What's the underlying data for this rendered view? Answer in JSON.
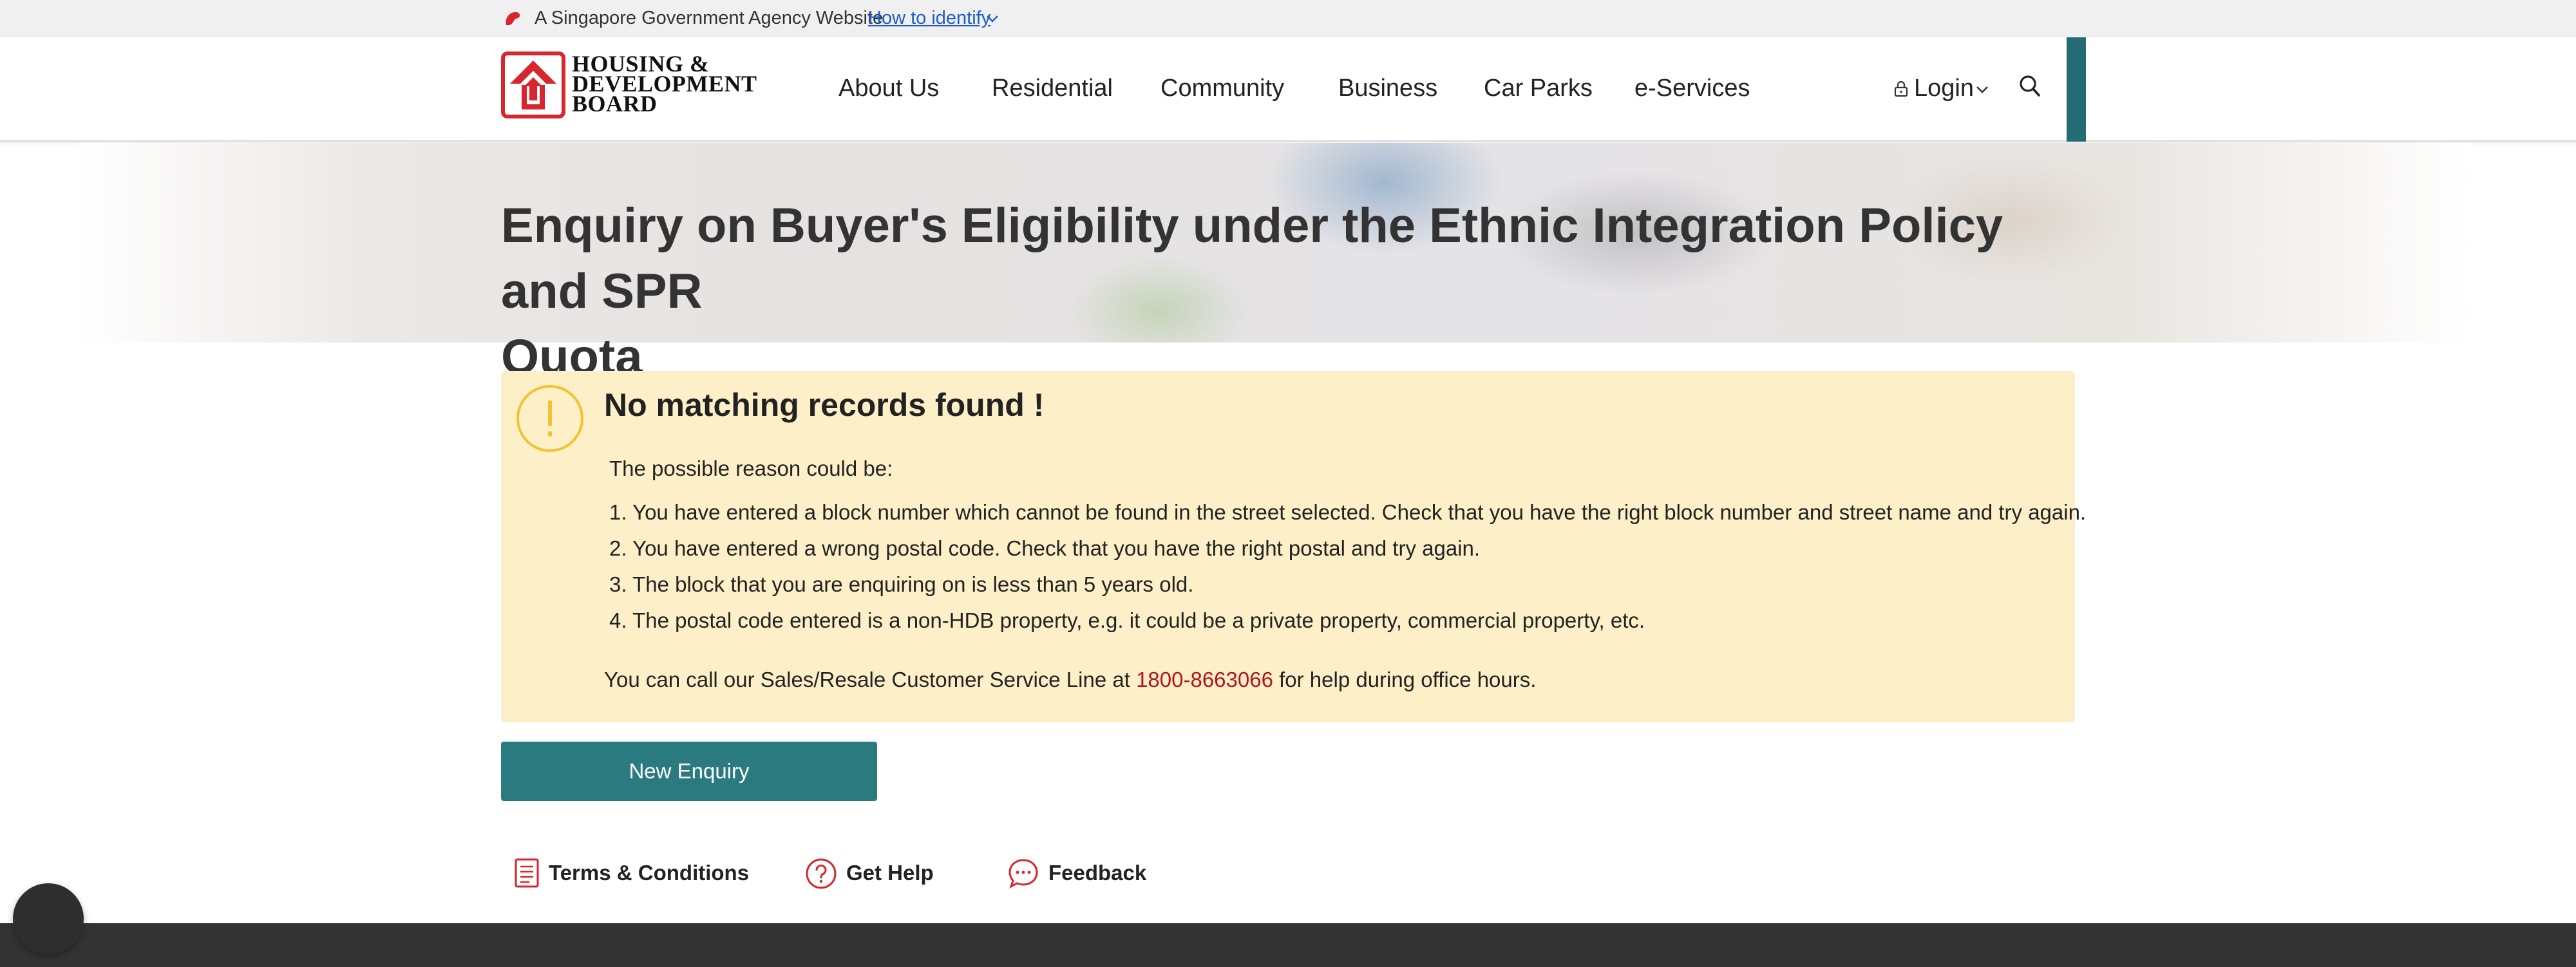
{
  "masthead": {
    "gov_text": "A Singapore Government Agency Website",
    "identify_link": "How to identify"
  },
  "header": {
    "logo_lines": [
      "HOUSING &",
      "DEVELOPMENT",
      "BOARD"
    ],
    "nav": [
      {
        "label": "About Us"
      },
      {
        "label": "Residential"
      },
      {
        "label": "Community"
      },
      {
        "label": "Business"
      },
      {
        "label": "Car Parks"
      },
      {
        "label": "e-Services"
      }
    ],
    "login_label": "Login"
  },
  "hero": {
    "title_line1": "Enquiry on Buyer's Eligibility under the Ethnic Integration Policy and SPR",
    "title_line2": "Quota"
  },
  "alert": {
    "title": "No matching records found !",
    "intro": "The possible reason could be:",
    "reasons": [
      "1. You have entered a block number which cannot be found in the street selected. Check that you have the right block number and street name and try again.",
      "2. You have entered a wrong postal code. Check that you have the right postal and try again.",
      "3. The block that you are enquiring on is less than 5 years old.",
      "4. The postal code entered is a non-HDB property, e.g. it could be a private property, commercial property, etc."
    ],
    "call_prefix": "You can call our Sales/Resale Customer Service Line at ",
    "phone": "1800-8663066",
    "call_suffix": " for help during office hours."
  },
  "actions": {
    "new_enquiry_label": "New Enquiry"
  },
  "footer_links": {
    "terms": "Terms & Conditions",
    "help": "Get Help",
    "feedback": "Feedback"
  },
  "colors": {
    "brand_red": "#d7262d",
    "teal": "#2b7a80",
    "alert_bg": "#fdf0c8",
    "phone_red": "#b3141b",
    "link_blue": "#1f5cc8"
  }
}
